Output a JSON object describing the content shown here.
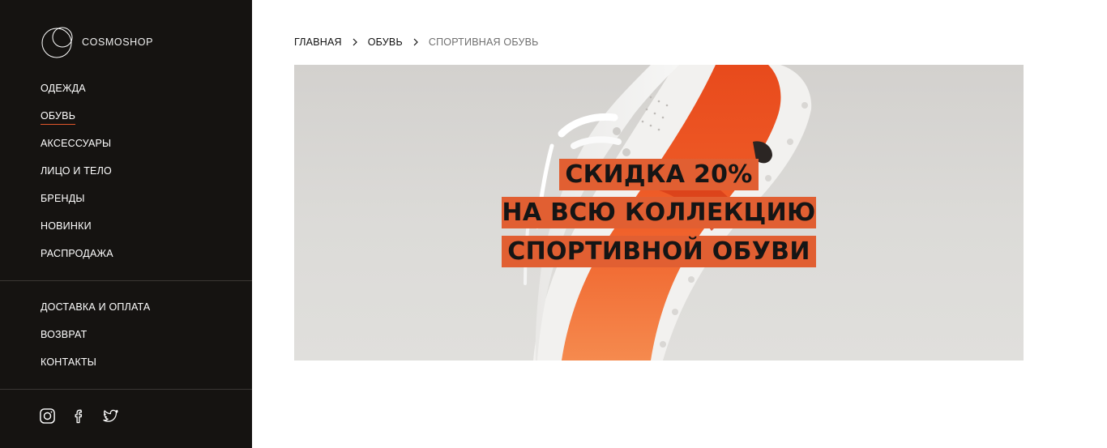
{
  "brand": {
    "name": "COSMOSHOP"
  },
  "sidebar": {
    "nav": [
      {
        "label": "ОДЕЖДА",
        "active": false
      },
      {
        "label": "ОБУВЬ",
        "active": true
      },
      {
        "label": "АКСЕССУАРЫ",
        "active": false
      },
      {
        "label": "ЛИЦО И ТЕЛО",
        "active": false
      },
      {
        "label": "БРЕНДЫ",
        "active": false
      },
      {
        "label": "НОВИНКИ",
        "active": false
      },
      {
        "label": "РАСПРОДАЖА",
        "active": false
      }
    ],
    "info": [
      {
        "label": "ДОСТАВКА И ОПЛАТА"
      },
      {
        "label": "ВОЗВРАТ"
      },
      {
        "label": "КОНТАКТЫ"
      }
    ],
    "social": [
      "instagram-icon",
      "facebook-icon",
      "twitter-icon"
    ]
  },
  "breadcrumb": {
    "items": [
      "ГЛАВНАЯ",
      "ОБУВЬ",
      "СПОРТИВНАЯ ОБУВЬ"
    ]
  },
  "banner": {
    "lines": [
      "СКИДКА 20%",
      "НА ВСЮ КОЛЛЕКЦИЮ",
      "СПОРТИВНОЙ ОБУВИ"
    ]
  },
  "colors": {
    "sidebar_bg": "#151311",
    "accent": "#e2572b",
    "promo_bg": "#e15f32",
    "text_dark": "#111111",
    "text_muted": "#6f6f6f"
  }
}
